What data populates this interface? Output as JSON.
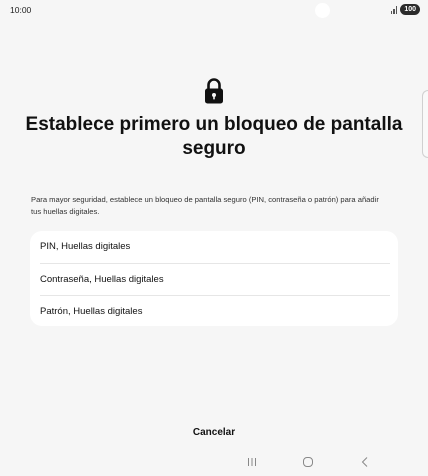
{
  "status_bar": {
    "time": "10:00",
    "battery": "100"
  },
  "screen": {
    "title": "Establece primero un bloqueo de pantalla seguro",
    "description": "Para mayor seguridad, establece un bloqueo de pantalla seguro (PIN, contraseña o patrón) para añadir tus huellas digitales.",
    "icon": "lock-icon"
  },
  "options": [
    {
      "label": "PIN, Huellas digitales"
    },
    {
      "label": "Contraseña, Huellas digitales"
    },
    {
      "label": "Patrón, Huellas digitales"
    }
  ],
  "footer": {
    "cancel_label": "Cancelar"
  },
  "nav": {
    "icons": [
      "recents-icon",
      "home-icon",
      "back-icon"
    ]
  }
}
